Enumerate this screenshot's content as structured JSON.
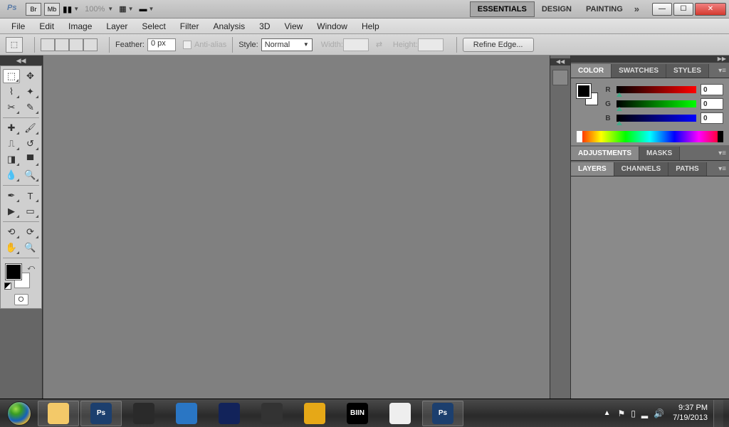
{
  "app": {
    "logo_text": "Ps",
    "br_btn": "Br",
    "mb_btn": "Mb",
    "zoom": "100%"
  },
  "workspaces": {
    "essentials": "ESSENTIALS",
    "design": "DESIGN",
    "painting": "PAINTING"
  },
  "menu": {
    "file": "File",
    "edit": "Edit",
    "image": "Image",
    "layer": "Layer",
    "select": "Select",
    "filter": "Filter",
    "analysis": "Analysis",
    "three_d": "3D",
    "view": "View",
    "window": "Window",
    "help": "Help"
  },
  "options": {
    "feather_label": "Feather:",
    "feather_value": "0 px",
    "antialias_label": "Anti-alias",
    "style_label": "Style:",
    "style_value": "Normal",
    "width_label": "Width:",
    "height_label": "Height:",
    "refine_label": "Refine Edge..."
  },
  "panels": {
    "color_tab": "COLOR",
    "swatches_tab": "SWATCHES",
    "styles_tab": "STYLES",
    "adjustments_tab": "ADJUSTMENTS",
    "masks_tab": "MASKS",
    "layers_tab": "LAYERS",
    "channels_tab": "CHANNELS",
    "paths_tab": "PATHS",
    "color": {
      "r_label": "R",
      "g_label": "G",
      "b_label": "B",
      "r": "0",
      "g": "0",
      "b": "0"
    }
  },
  "taskbar": {
    "items": [
      {
        "name": "explorer",
        "color": "#f3c969"
      },
      {
        "name": "photoshop",
        "color": "#1c3f6e"
      },
      {
        "name": "xl",
        "color": "#2a2a2a"
      },
      {
        "name": "ie",
        "color": "#2a76c4"
      },
      {
        "name": "pb",
        "color": "#12235a"
      },
      {
        "name": "wmc",
        "color": "#333"
      },
      {
        "name": "aimp",
        "color": "#e6a817"
      },
      {
        "name": "biin",
        "color": "#000",
        "text": "BIIN"
      },
      {
        "name": "chrome",
        "color": "#eee"
      },
      {
        "name": "photoshop2",
        "color": "#1c3f6e"
      }
    ],
    "time": "9:37 PM",
    "date": "7/19/2013"
  }
}
